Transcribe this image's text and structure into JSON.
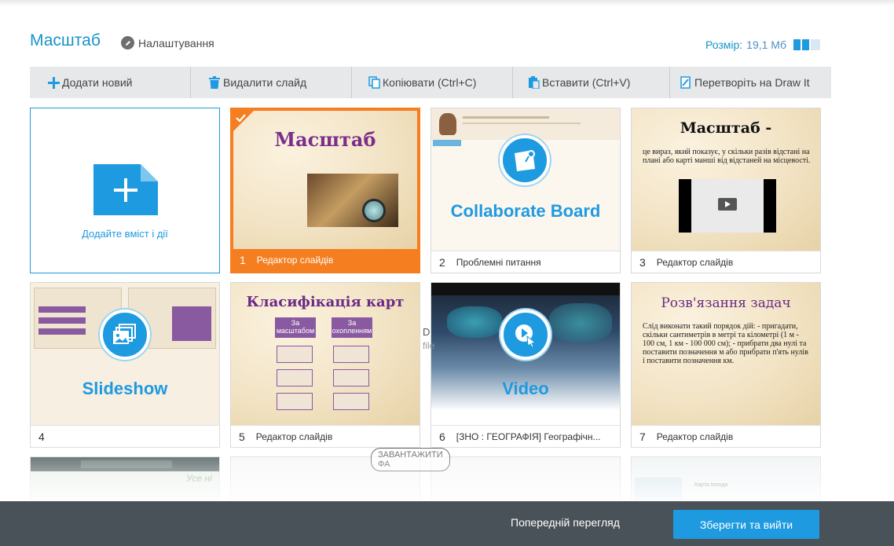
{
  "header": {
    "title": "Масштаб",
    "settings_label": "Налаштування",
    "size_label": "Розмір:",
    "size_value": "19,1 Мб"
  },
  "toolbar": {
    "add": "Додати новий",
    "delete": "Видалити слайд",
    "copy": "Копіювати (Ctrl+C)",
    "paste": "Вставити (Ctrl+V)",
    "convert": "Перетворіть на Draw It"
  },
  "add_card": {
    "label": "Додайте вміст і дії"
  },
  "slides": [
    {
      "num": "1",
      "caption": "Редактор слайдів",
      "title": "Масштаб"
    },
    {
      "num": "2",
      "caption": "Проблемні питання",
      "type": "Collaborate Board"
    },
    {
      "num": "3",
      "caption": "Редактор слайдів",
      "title": "Масштаб -",
      "body": "це вираз, який показує, у скільки разів відстані на плані або карті манші від відстаней на місцевості."
    },
    {
      "num": "4",
      "caption": "",
      "type": "Slideshow"
    },
    {
      "num": "5",
      "caption": "Редактор слайдів",
      "title": "Класифікація карт",
      "boxes": [
        "За масштабом",
        "За охопленням"
      ]
    },
    {
      "num": "6",
      "caption": "[ЗНО : ГЕОГРАФІЯ] Географічн...",
      "type": "Video"
    },
    {
      "num": "7",
      "caption": "Редактор слайдів",
      "title": "Розв'язання задач",
      "body": "Слід виконати такий порядок дій: - пригадати, скільки сантиметрів в метрі та кілометрі (1 м - 100 см, 1 км - 100 000 см); - прибрати два нулі та поставити позначення м або прибрати п'ять нулів і поставити позначення км."
    }
  ],
  "row3": [
    {
      "snippet": "Усе ні"
    },
    {
      "snippet": ""
    },
    {
      "snippet": ""
    },
    {
      "snippet": "Карта погоди"
    }
  ],
  "stray": {
    "d": "D",
    "file": "file",
    "download": "ЗАВАНТАЖИТИ ФА"
  },
  "footer": {
    "preview": "Попередній перегляд",
    "save": "Зберегти та вийти"
  },
  "colors": {
    "accent": "#1e9ae0",
    "selected": "#f47e20",
    "footer": "#4a5259"
  }
}
